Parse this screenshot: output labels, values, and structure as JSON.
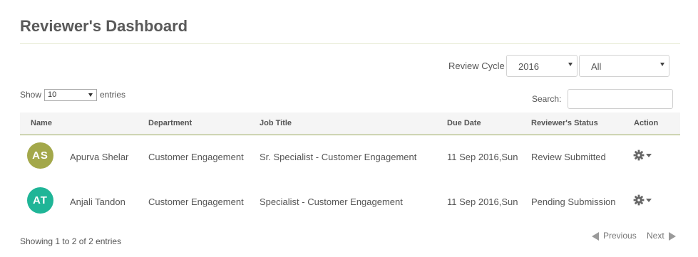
{
  "page": {
    "title": "Reviewer's Dashboard"
  },
  "filters": {
    "review_cycle_label": "Review Cycle",
    "year_value": "2016",
    "status_value": "All"
  },
  "table_controls": {
    "show_label": "Show",
    "page_length_value": "10",
    "entries_label": "entries",
    "search_label": "Search:",
    "search_value": ""
  },
  "table": {
    "columns": [
      "Name",
      "Department",
      "Job Title",
      "Due Date",
      "Reviewer's Status",
      "Action"
    ],
    "rows": [
      {
        "initials": "AS",
        "avatar_color": "#a3a84a",
        "name": "Apurva Shelar",
        "department": "Customer Engagement",
        "job_title": "Sr. Specialist - Customer Engagement",
        "due_date": "11 Sep 2016,Sun",
        "status": "Review Submitted",
        "action_icon": "gear-icon"
      },
      {
        "initials": "AT",
        "avatar_color": "#1fb597",
        "name": "Anjali Tandon",
        "department": "Customer Engagement",
        "job_title": "Specialist - Customer Engagement",
        "due_date": "11 Sep 2016,Sun",
        "status": "Pending Submission",
        "action_icon": "gear-icon"
      }
    ]
  },
  "footer": {
    "info": "Showing 1 to 2 of 2 entries",
    "previous_label": "Previous",
    "next_label": "Next"
  },
  "colors": {
    "accent_rule": "#9aa85a",
    "title_rule": "#e6ead2"
  }
}
